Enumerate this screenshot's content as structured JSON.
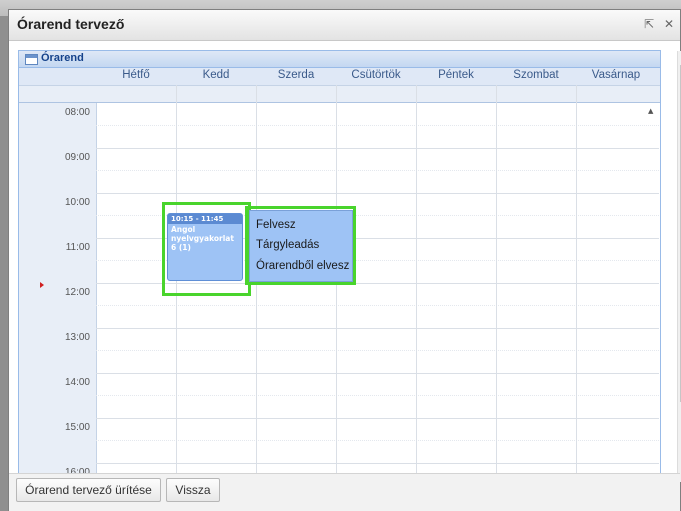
{
  "window": {
    "title": "Órarend tervező"
  },
  "calendar": {
    "panel_title": "Órarend",
    "days": [
      "Hétfő",
      "Kedd",
      "Szerda",
      "Csütörtök",
      "Péntek",
      "Szombat",
      "Vasárnap"
    ],
    "hours": [
      "08:00",
      "09:00",
      "10:00",
      "11:00",
      "12:00",
      "13:00",
      "14:00",
      "15:00",
      "16:00"
    ]
  },
  "event": {
    "time": "10:15 - 11:45",
    "title": "Angol nyelvgyakorlat 6 (1)"
  },
  "context_menu": {
    "items": [
      "Felvesz",
      "Tárgyleadás",
      "Órarendből elvesz"
    ]
  },
  "footer": {
    "clear_label": "Órarend tervező ürítése",
    "back_label": "Vissza"
  },
  "colors": {
    "highlight": "#49d42c",
    "event_bg": "#9ec3f5",
    "header_text": "#15428b"
  }
}
